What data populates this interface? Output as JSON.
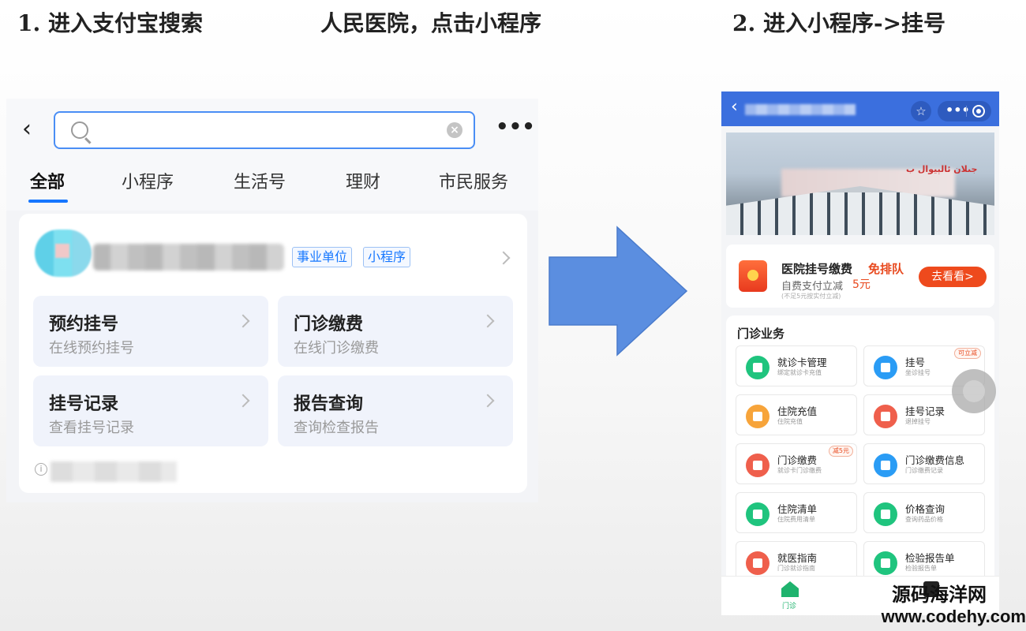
{
  "captions": {
    "step1_left": "1. 进入支付宝搜索",
    "step1_right": "人民医院，点击小程序",
    "step2": "2. 进入小程序->挂号"
  },
  "search_screen": {
    "search": {
      "value": "",
      "placeholder": ""
    },
    "icons": {
      "back": "back-arrow-icon",
      "search": "search-icon",
      "clear": "clear-icon",
      "more": "more-icon"
    },
    "more_label": "•••",
    "tabs": [
      "全部",
      "小程序",
      "生活号",
      "理财",
      "市民服务"
    ],
    "active_tab": "全部",
    "result": {
      "tags": [
        "事业单位",
        "小程序"
      ],
      "services": [
        {
          "title": "预约挂号",
          "subtitle": "在线预约挂号"
        },
        {
          "title": "门诊缴费",
          "subtitle": "在线门诊缴费"
        },
        {
          "title": "挂号记录",
          "subtitle": "查看挂号记录"
        },
        {
          "title": "报告查询",
          "subtitle": "查询检查报告"
        }
      ]
    },
    "colors": {
      "accent": "#1677ff",
      "background": "#f3f4f7"
    }
  },
  "mini_program": {
    "header": {
      "back": "‹",
      "more": "•••",
      "colors": {
        "bar": "#3b6fde"
      }
    },
    "banner": {
      "sign": "جىلان ئالېيوال ب"
    },
    "promo": {
      "title": "医院挂号缴费",
      "highlight": "免排队",
      "subtitle": "自费支付立减",
      "amount": "5元",
      "note": "(不足5元按实付立减)",
      "button": "去看看>"
    },
    "clinic": {
      "title": "门诊业务",
      "items": [
        {
          "title": "就诊卡管理",
          "subtitle": "绑定就诊卡充值",
          "icon": "card-icon",
          "color": "#1fc47e",
          "badge": ""
        },
        {
          "title": "挂号",
          "subtitle": "坐诊挂号",
          "icon": "clock-icon",
          "color": "#2a9cf5",
          "badge": "可立减"
        },
        {
          "title": "住院充值",
          "subtitle": "住院充值",
          "icon": "wallet-icon",
          "color": "#f7a43a",
          "badge": ""
        },
        {
          "title": "挂号记录",
          "subtitle": "退掉挂号",
          "icon": "record-icon",
          "color": "#ef5f4c",
          "badge": ""
        },
        {
          "title": "门诊缴费",
          "subtitle": "就诊卡门诊缴费",
          "icon": "payment-icon",
          "color": "#ef5f4c",
          "badge": "减5元"
        },
        {
          "title": "门诊缴费信息",
          "subtitle": "门诊缴费记录",
          "icon": "list-icon",
          "color": "#2a9cf5",
          "badge": ""
        },
        {
          "title": "住院清单",
          "subtitle": "住院费用清单",
          "icon": "bill-icon",
          "color": "#1fc47e",
          "badge": ""
        },
        {
          "title": "价格查询",
          "subtitle": "查询药品价格",
          "icon": "price-icon",
          "color": "#1fc47e",
          "badge": ""
        },
        {
          "title": "就医指南",
          "subtitle": "门诊就诊指南",
          "icon": "guide-icon",
          "color": "#ef5f4c",
          "badge": ""
        },
        {
          "title": "检验报告单",
          "subtitle": "检验报告单",
          "icon": "report-icon",
          "color": "#1fc47e",
          "badge": ""
        }
      ]
    },
    "tabbar": {
      "home_label": "门诊"
    }
  },
  "watermark": {
    "line1": "源码海洋网",
    "line2": "www.codehy.com"
  }
}
